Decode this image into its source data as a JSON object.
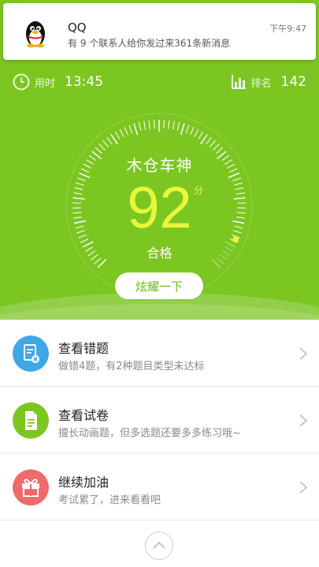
{
  "notification": {
    "app": "QQ",
    "message": "有 9 个联系人给你发过来361条新消息",
    "time": "下午9:47",
    "icon": "qq-penguin-icon"
  },
  "stats": {
    "time_label": "用时",
    "time_value": "13:45",
    "rank_label": "排名",
    "rank_value": "142"
  },
  "result": {
    "title": "木仓车神",
    "score": "92",
    "unit": "分",
    "grade": "合格",
    "gauge_level": 0.92,
    "share_label": "炫耀一下"
  },
  "list": {
    "items": [
      {
        "title": "查看错题",
        "subtitle": "做错4题，有2种题目类型未达标",
        "icon": "wrong-answers-icon",
        "color": "#3ea8e6"
      },
      {
        "title": "查看试卷",
        "subtitle": "擅长动画题，但多选题还要多多练习哦~",
        "icon": "document-icon",
        "color": "#7cc622"
      },
      {
        "title": "继续加油",
        "subtitle": "考试累了，进来看看吧",
        "icon": "gift-icon",
        "color": "#f06a6a"
      }
    ]
  },
  "colors": {
    "brand_green": "#7cc622",
    "score_yellow": "#e8f73a"
  }
}
